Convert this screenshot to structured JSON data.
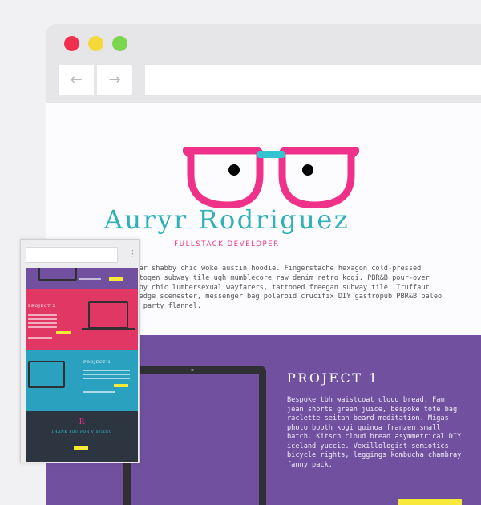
{
  "window": {
    "controls": [
      "close",
      "minimize",
      "maximize"
    ],
    "colors": {
      "close": "#f0314d",
      "minimize": "#f5d83a",
      "maximize": "#7bd64d"
    },
    "nav": {
      "back_icon": "←",
      "forward_icon": "→"
    }
  },
  "hero": {
    "logo_icon": "glasses-icon",
    "name": "Auryr Rodriguez",
    "subtitle": "FULLSTACK DEVELOPER",
    "intro": "eytar shabby chic woke austin hoodie. Fingerstache hexagon cold-pressed\ndaptogen subway tile ugh mumblecore raw denim retro kogi. PBR&B pour-over\nhabby chic lumbersexual wayfarers, tattooed freegan subway tile. Truffaut\nve-edge scenester, messenger bag polaroid crucifix DIY gastropub PBR&B paleo\noof party flannel."
  },
  "project": {
    "title": "PROJECT 1",
    "description": "Bespoke tbh waistcoat cloud bread. Fam\njean shorts green juice, bespoke tote bag\nraclette seitan beard meditation. Migas\nphoto booth kogi quinoa franzen small\nbatch. Kitsch cloud bread asymmetrical DIY\niceland yuccie. Vexillologist semiotics\nbicycle rights, leggings kombucha chambray\nfanny pack."
  },
  "mobile_preview": {
    "menu_icon": "⋮",
    "sections": [
      {
        "title": ""
      },
      {
        "title": "PROJECT 2"
      },
      {
        "title": "PROJECT 3"
      },
      {
        "title": "THANK YOU FOR VISITING",
        "mark": "R"
      }
    ]
  },
  "colors": {
    "accent_pink": "#f0318a",
    "accent_teal": "#2eb1b9",
    "purple": "#7150a0",
    "red": "#e13765",
    "blue": "#2aa1bf",
    "dark": "#2c3540",
    "button_yellow": "#f7e93a"
  }
}
